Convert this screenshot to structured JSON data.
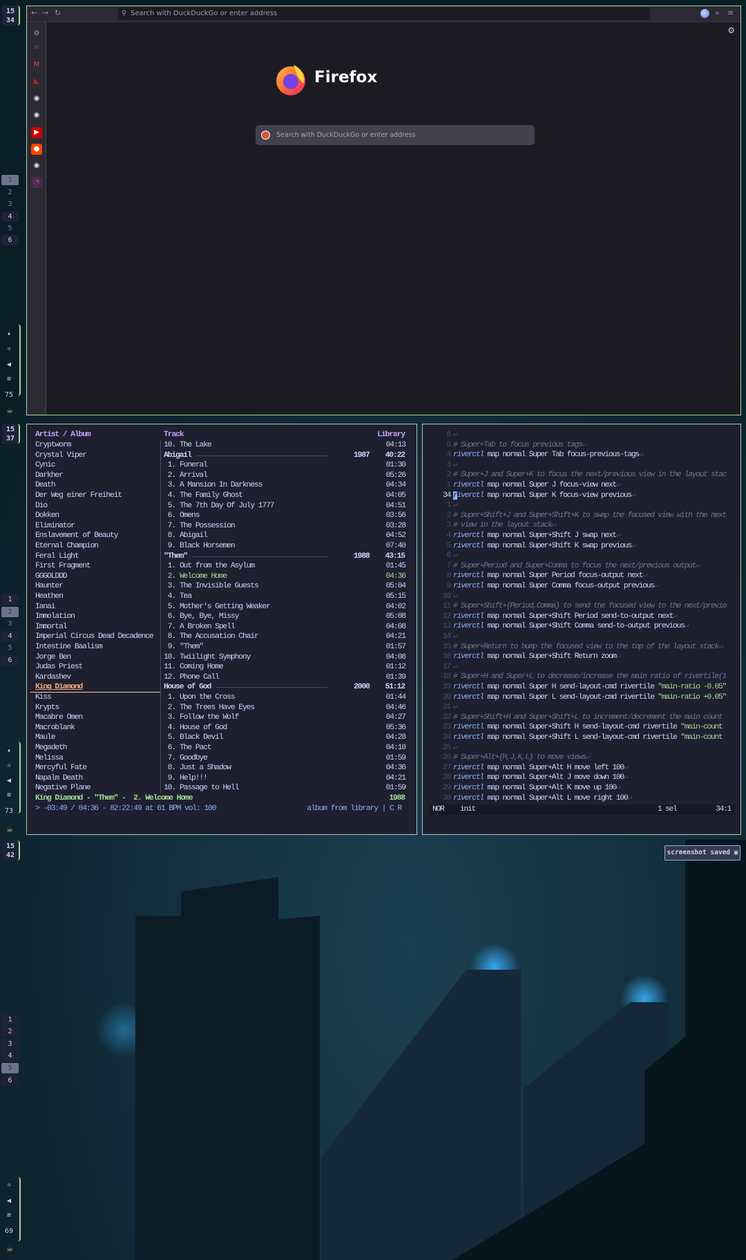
{
  "colors": {
    "accent_green": "#a6da95",
    "header": "#c6a0f6",
    "playing": "#a6da95",
    "selected_artist": "#f5a97f",
    "status_blue": "#8aadf4",
    "firefox_bg": "#1c1b22",
    "panel_bg": "#1e2030"
  },
  "bar_sections": [
    {
      "clock": {
        "h": "15",
        "m": "34"
      },
      "workspaces": [
        {
          "label": "1",
          "state": "active"
        },
        {
          "label": "2",
          "state": "empty"
        },
        {
          "label": "3",
          "state": "empty"
        },
        {
          "label": "4",
          "state": "occupied"
        },
        {
          "label": "5",
          "state": "empty"
        },
        {
          "label": "6",
          "state": "occupied"
        }
      ],
      "status": [
        {
          "icon": "battery-icon"
        },
        {
          "icon": "brightness-icon"
        },
        {
          "icon": "volume-icon"
        },
        {
          "icon": "wifi-icon"
        },
        {
          "text": "75"
        }
      ],
      "launcher_icon": "bowl-icon"
    },
    {
      "clock": {
        "h": "15",
        "m": "37"
      },
      "workspaces": [
        {
          "label": "1",
          "state": "occupied"
        },
        {
          "label": "2",
          "state": "active"
        },
        {
          "label": "3",
          "state": "empty"
        },
        {
          "label": "4",
          "state": "occupied"
        },
        {
          "label": "5",
          "state": "empty"
        },
        {
          "label": "6",
          "state": "occupied"
        }
      ],
      "status": [
        {
          "icon": "battery-icon"
        },
        {
          "icon": "brightness-icon"
        },
        {
          "icon": "volume-icon"
        },
        {
          "icon": "wifi-icon"
        },
        {
          "text": "73"
        }
      ],
      "launcher_icon": "bowl-icon"
    },
    {
      "clock": {
        "h": "15",
        "m": "42"
      },
      "workspaces": [
        {
          "label": "1",
          "state": "occupied"
        },
        {
          "label": "2",
          "state": "occupied"
        },
        {
          "label": "3",
          "state": "occupied"
        },
        {
          "label": "4",
          "state": "occupied"
        },
        {
          "label": "5",
          "state": "active"
        },
        {
          "label": "6",
          "state": "occupied"
        }
      ],
      "status": [
        {
          "icon": "brightness-icon"
        },
        {
          "icon": "volume-icon"
        },
        {
          "icon": "wifi-icon"
        },
        {
          "text": "69"
        }
      ],
      "launcher_icon": "bowl-icon"
    }
  ],
  "firefox": {
    "url_placeholder": "Search with DuckDuckGo or enter address",
    "brand": "Firefox",
    "search_placeholder": "Search with DuckDuckGo or enter address",
    "sidebar_icons": [
      "settings-icon",
      "list-icon",
      "gmail-icon",
      "bookmark-icon",
      "github-icon",
      "github-icon",
      "youtube-icon",
      "reddit-icon",
      "github-icon",
      "firefox-icon"
    ]
  },
  "player": {
    "headers": {
      "artist": "Artist / Album",
      "track": "Track",
      "library": "Library"
    },
    "artists": [
      "Cryptworm",
      "Crystal Viper",
      "Cynic",
      "Darkher",
      "Death",
      "Der Weg einer Freiheit",
      "Dio",
      "Dokken",
      "Eliminator",
      "Enslavement of Beauty",
      "Eternal Champion",
      "Feral Light",
      "First Fragment",
      "GGGOLDDD",
      "Haunter",
      "Heathen",
      "Ianai",
      "Immolation",
      "Immortal",
      "Imperial Circus Dead Decadence",
      "Intestine Baalism",
      "Jorge Ben",
      "Judas Priest",
      "Kardashev",
      "King Diamond",
      "Kiss",
      "Krypts",
      "Macabre Omen",
      "Macroblank",
      "Maule",
      "Megadeth",
      "Melissa",
      "Mercyful Fate",
      "Napalm Death",
      "Negative Plane"
    ],
    "selected_artist": "King Diamond",
    "tracks": [
      {
        "num": "10.",
        "title": "The Lake",
        "time": "04:13"
      },
      {
        "album": "Abigail",
        "year": "1987",
        "duration": "40:22"
      },
      {
        "num": "1.",
        "title": "Funeral",
        "time": "01:30"
      },
      {
        "num": "2.",
        "title": "Arrival",
        "time": "05:26"
      },
      {
        "num": "3.",
        "title": "A Mansion In Darkness",
        "time": "04:34"
      },
      {
        "num": "4.",
        "title": "The Family Ghost",
        "time": "04:05"
      },
      {
        "num": "5.",
        "title": "The 7th Day Of July 1777",
        "time": "04:51"
      },
      {
        "num": "6.",
        "title": "Omens",
        "time": "03:56"
      },
      {
        "num": "7.",
        "title": "The Possession",
        "time": "03:28"
      },
      {
        "num": "8.",
        "title": "Abigail",
        "time": "04:52"
      },
      {
        "num": "9.",
        "title": "Black Horsemen",
        "time": "07:40"
      },
      {
        "album": "\"Them\"",
        "year": "1988",
        "duration": "43:15"
      },
      {
        "num": "1.",
        "title": "Out from the Asylum",
        "time": "01:45"
      },
      {
        "num": "2.",
        "title": "Welcome Home",
        "time": "04:36",
        "playing": true
      },
      {
        "num": "3.",
        "title": "The Invisible Guests",
        "time": "05:04"
      },
      {
        "num": "4.",
        "title": "Tea",
        "time": "05:15"
      },
      {
        "num": "5.",
        "title": "Mother's Getting Weaker",
        "time": "04:02"
      },
      {
        "num": "6.",
        "title": "Bye, Bye, Missy",
        "time": "05:08"
      },
      {
        "num": "7.",
        "title": "A Broken Spell",
        "time": "04:08"
      },
      {
        "num": "8.",
        "title": "The Accusation Chair",
        "time": "04:21"
      },
      {
        "num": "9.",
        "title": "\"Them\"",
        "time": "01:57"
      },
      {
        "num": "10.",
        "title": "Twiilight Symphony",
        "time": "04:08"
      },
      {
        "num": "11.",
        "title": "Coming Home",
        "time": "01:12"
      },
      {
        "num": "12.",
        "title": "Phone Call",
        "time": "01:39"
      },
      {
        "album": "House of God",
        "year": "2000",
        "duration": "51:12"
      },
      {
        "num": "1.",
        "title": "Upon the Cross",
        "time": "01:44"
      },
      {
        "num": "2.",
        "title": "The Trees Have Eyes",
        "time": "04:46"
      },
      {
        "num": "3.",
        "title": "Follow the Wolf",
        "time": "04:27"
      },
      {
        "num": "4.",
        "title": "House of God",
        "time": "05:36"
      },
      {
        "num": "5.",
        "title": "Black Devil",
        "time": "04:28"
      },
      {
        "num": "6.",
        "title": "The Pact",
        "time": "04:10"
      },
      {
        "num": "7.",
        "title": "Goodbye",
        "time": "01:59"
      },
      {
        "num": "8.",
        "title": "Just a Shadow",
        "time": "04:36"
      },
      {
        "num": "9.",
        "title": "Help!!!",
        "time": "04:21"
      },
      {
        "num": "10.",
        "title": "Passage to Hell",
        "time": "01:59"
      }
    ],
    "now_playing": "King Diamond - \"Them\" -  2. Welcome Home",
    "now_playing_year": "1988",
    "status_left": "> -03:49 / 04:36 - 82:22:49 at 61 BPM vol: 100",
    "status_right": "album from library | C R"
  },
  "editor": {
    "lines": [
      {
        "n": "6",
        "text": "",
        "eol": true
      },
      {
        "n": "5",
        "text": "# Super+Tab to focus previous tags",
        "eol": true
      },
      {
        "n": "4",
        "text": "riverctl map normal Super Tab focus-previous-tags",
        "eol": true
      },
      {
        "n": "3",
        "text": "",
        "eol": true
      },
      {
        "n": "2",
        "text": "# Super+J and Super+K to focus the next/previous view in the layout stac",
        "eol": false
      },
      {
        "n": "1",
        "text": "riverctl map normal Super J focus-view next",
        "eol": true
      },
      {
        "n": "34",
        "text": "riverctl map normal Super K focus-view previous",
        "eol": true,
        "current": true
      },
      {
        "n": "1",
        "text": "",
        "eol": true
      },
      {
        "n": "2",
        "text": "# Super+Shift+J and Super+Shift+K to swap the focused view with the next",
        "eol": false
      },
      {
        "n": "3",
        "text": "# view in the layout stack",
        "eol": true
      },
      {
        "n": "4",
        "text": "riverctl map normal Super+Shift J swap next",
        "eol": true
      },
      {
        "n": "5",
        "text": "riverctl map normal Super+Shift K swap previous",
        "eol": true
      },
      {
        "n": "6",
        "text": "",
        "eol": true
      },
      {
        "n": "7",
        "text": "# Super+Period and Super+Comma to focus the next/previous output",
        "eol": true
      },
      {
        "n": "8",
        "text": "riverctl map normal Super Period focus-output next",
        "eol": true
      },
      {
        "n": "9",
        "text": "riverctl map normal Super Comma focus-output previous",
        "eol": true
      },
      {
        "n": "10",
        "text": "",
        "eol": true
      },
      {
        "n": "11",
        "text": "# Super+Shift+{Period,Comma} to send the focused view to the next/previo",
        "eol": false
      },
      {
        "n": "12",
        "text": "riverctl map normal Super+Shift Period send-to-output next",
        "eol": true
      },
      {
        "n": "13",
        "text": "riverctl map normal Super+Shift Comma send-to-output previous",
        "eol": true
      },
      {
        "n": "14",
        "text": "",
        "eol": true
      },
      {
        "n": "15",
        "text": "# Super+Return to bump the focused view to the top of the layout stack",
        "eol": true
      },
      {
        "n": "16",
        "text": "riverctl map normal Super+Shift Return zoom",
        "eol": true
      },
      {
        "n": "17",
        "text": "",
        "eol": true
      },
      {
        "n": "18",
        "text": "# Super+H and Super+L to decrease/increase the main ratio of rivertile(1",
        "eol": false
      },
      {
        "n": "19",
        "text": "riverctl map normal Super H send-layout-cmd rivertile \"main-ratio -0.05\"",
        "eol": false
      },
      {
        "n": "20",
        "text": "riverctl map normal Super L send-layout-cmd rivertile \"main-ratio +0.05\"",
        "eol": false
      },
      {
        "n": "21",
        "text": "",
        "eol": true
      },
      {
        "n": "22",
        "text": "# Super+Shift+H and Super+Shift+L to increment/decrement the main count ",
        "eol": false
      },
      {
        "n": "23",
        "text": "riverctl map normal Super+Shift H send-layout-cmd rivertile \"main-count ",
        "eol": false
      },
      {
        "n": "24",
        "text": "riverctl map normal Super+Shift L send-layout-cmd rivertile \"main-count ",
        "eol": false
      },
      {
        "n": "25",
        "text": "",
        "eol": true
      },
      {
        "n": "26",
        "text": "# Super+Alt+{H,J,K,L} to move views",
        "eol": true
      },
      {
        "n": "27",
        "text": "riverctl map normal Super+Alt H move left 100",
        "eol": true
      },
      {
        "n": "28",
        "text": "riverctl map normal Super+Alt J move down 100",
        "eol": true
      },
      {
        "n": "29",
        "text": "riverctl map normal Super+Alt K move up 100",
        "eol": true
      },
      {
        "n": "30",
        "text": "riverctl map normal Super+Alt L move right 100",
        "eol": true
      }
    ],
    "status": {
      "mode": "NOR",
      "file": "init",
      "selections": "1 sel",
      "position": "34:1"
    }
  },
  "notification": {
    "text": "screenshot saved",
    "icon": "camera-icon"
  }
}
